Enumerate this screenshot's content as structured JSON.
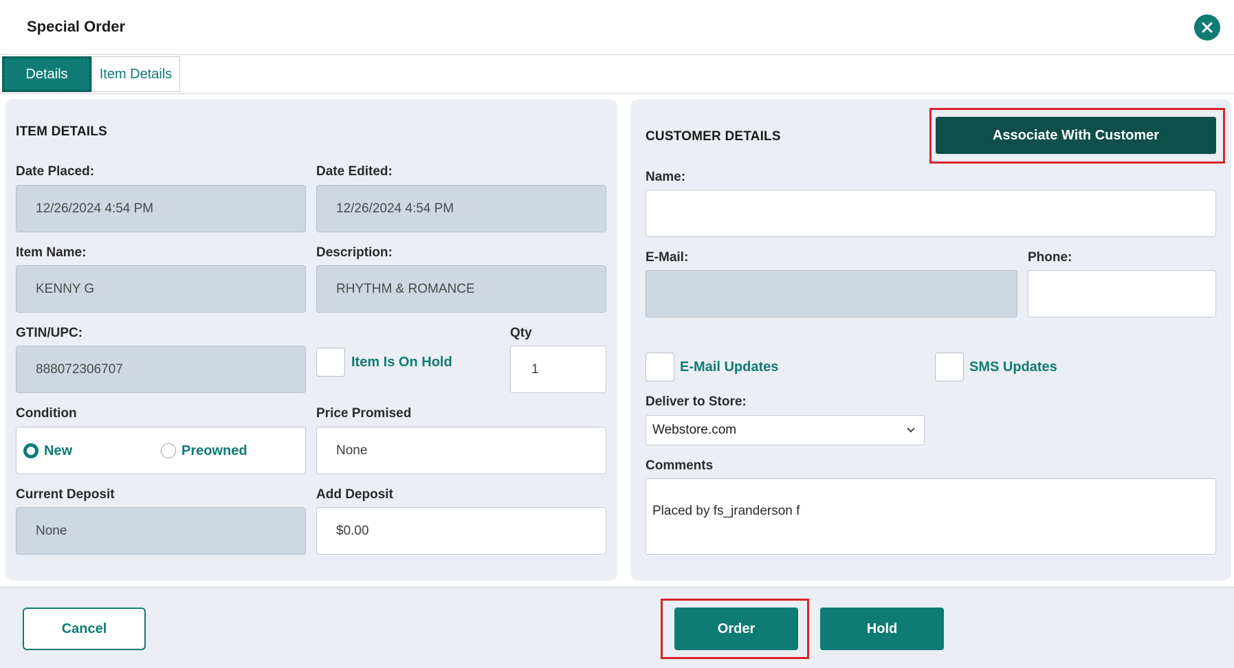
{
  "dialog": {
    "title": "Special Order"
  },
  "tabs": [
    {
      "label": "Details",
      "active": true
    },
    {
      "label": "Item Details",
      "active": false
    }
  ],
  "item_details": {
    "heading": "ITEM DETAILS",
    "date_placed": {
      "label": "Date Placed:",
      "value": "12/26/2024 4:54 PM"
    },
    "date_edited": {
      "label": "Date Edited:",
      "value": "12/26/2024 4:54 PM"
    },
    "item_name": {
      "label": "Item Name:",
      "value": "KENNY G"
    },
    "description": {
      "label": "Description:",
      "value": "RHYTHM & ROMANCE"
    },
    "gtin": {
      "label": "GTIN/UPC:",
      "value": "888072306707"
    },
    "on_hold": {
      "label": "Item Is On Hold",
      "checked": false
    },
    "qty": {
      "label": "Qty",
      "value": "1"
    },
    "condition": {
      "label": "Condition",
      "options": [
        {
          "label": "New",
          "selected": true
        },
        {
          "label": "Preowned",
          "selected": false
        }
      ]
    },
    "price_promised": {
      "label": "Price Promised",
      "value": "None"
    },
    "current_deposit": {
      "label": "Current Deposit",
      "value": "None"
    },
    "add_deposit": {
      "label": "Add Deposit",
      "value": "$0.00"
    }
  },
  "customer_details": {
    "heading": "CUSTOMER DETAILS",
    "associate_button": "Associate With Customer",
    "name": {
      "label": "Name:",
      "value": ""
    },
    "email": {
      "label": "E-Mail:",
      "value": ""
    },
    "phone": {
      "label": "Phone:",
      "value": ""
    },
    "email_updates": {
      "label": "E-Mail Updates",
      "checked": false
    },
    "sms_updates": {
      "label": "SMS Updates",
      "checked": false
    },
    "deliver_to_store": {
      "label": "Deliver to Store:",
      "value": "Webstore.com"
    },
    "comments": {
      "label": "Comments",
      "value": "Placed by fs_jranderson f"
    }
  },
  "footer": {
    "cancel": "Cancel",
    "order": "Order",
    "hold": "Hold"
  },
  "colors": {
    "accent": "#0f7b75",
    "dark_accent": "#0e4e4b",
    "highlight": "#d9232d",
    "panel_bg": "#ebeef4",
    "readonly_field": "#ced7e2"
  },
  "icons": {
    "close": "close-icon",
    "dropdown": "chevron-down-icon"
  }
}
